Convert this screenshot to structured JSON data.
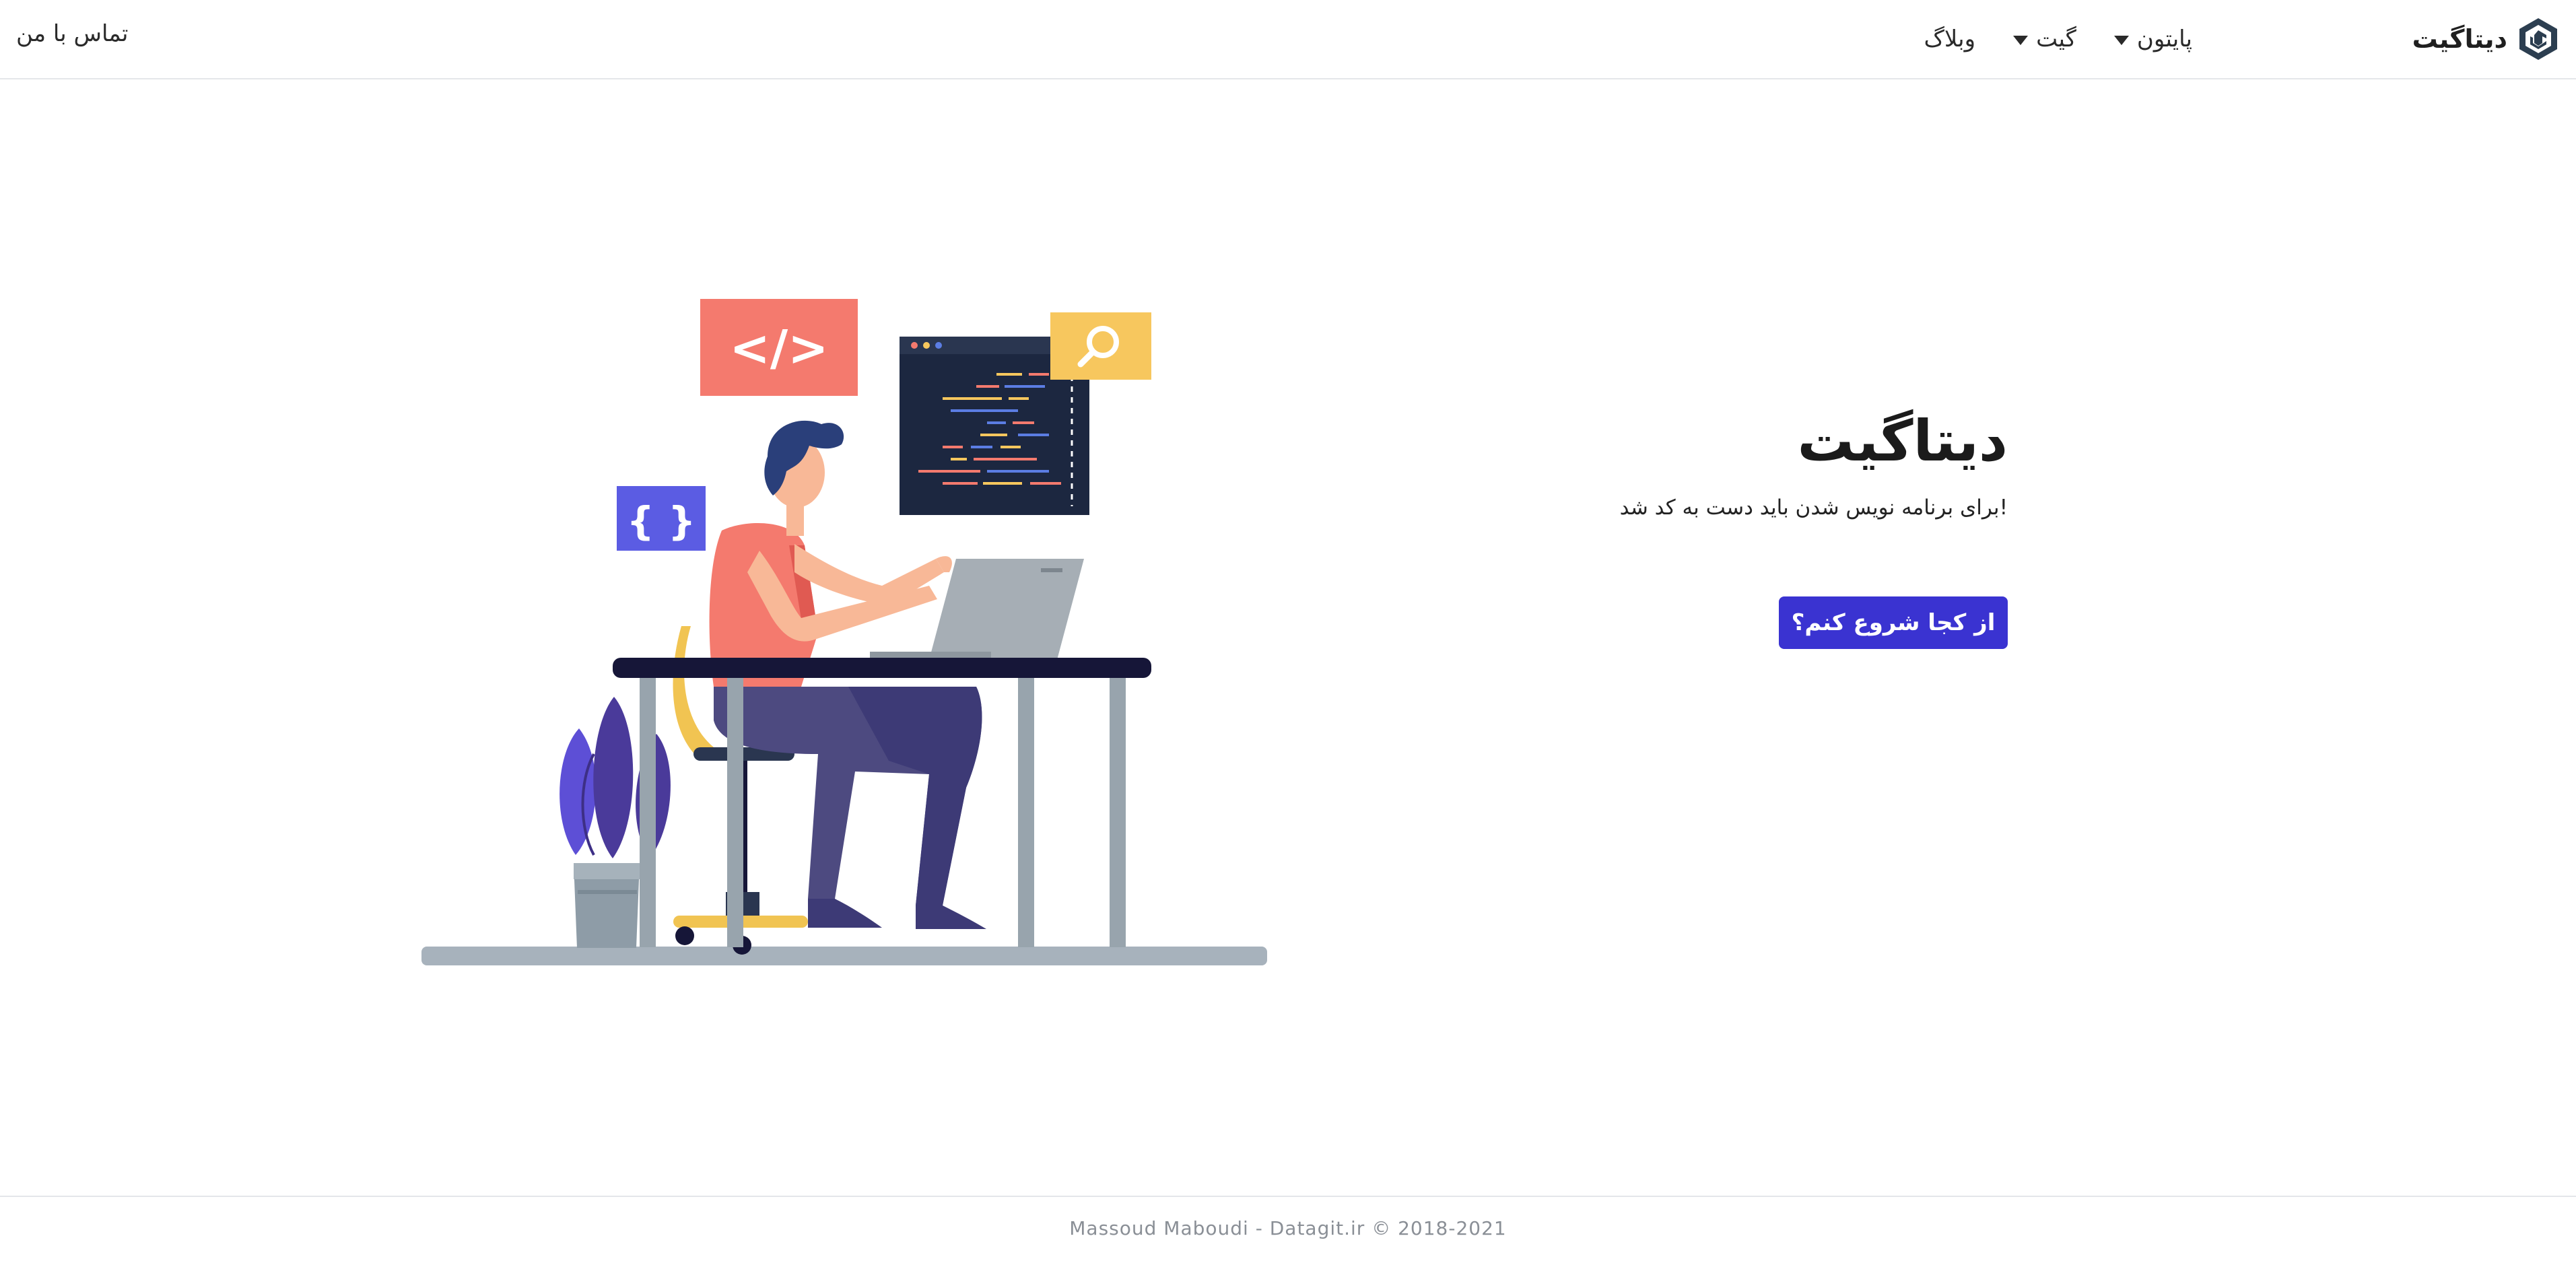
{
  "nav": {
    "brand": "دیتاگیت",
    "items": [
      {
        "label": "پایتون",
        "has_dropdown": true
      },
      {
        "label": "گیت",
        "has_dropdown": true
      },
      {
        "label": "وبلاگ",
        "has_dropdown": false
      }
    ],
    "contact": "تماس با من"
  },
  "hero": {
    "title": "دیتاگیت",
    "subtitle": "برای برنامه نویس شدن باید دست به کد شد!",
    "cta": "از کجا شروع کنم؟"
  },
  "illustration": {
    "code_sign": "</>",
    "braces_sign": "{ }"
  },
  "footer": {
    "text": "Massoud Maboudi - Datagit.ir © 2018-2021"
  },
  "colors": {
    "primary": "#3a33d1",
    "code_card": "#f47a6e",
    "search_card": "#f7c75e",
    "braces_card": "#5b5ce3",
    "monitor": "#1c2740",
    "desk": "#161638"
  }
}
